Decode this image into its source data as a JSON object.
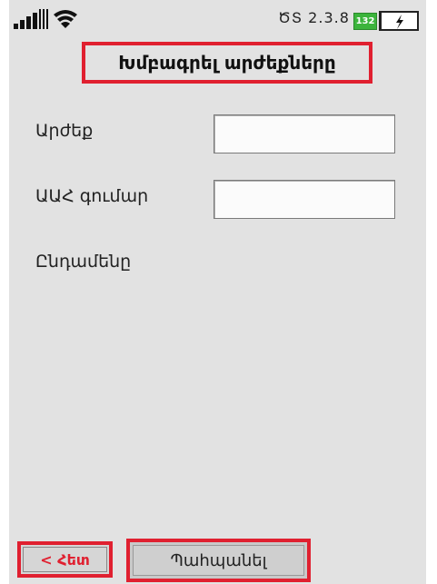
{
  "status_bar": {
    "signal_icon": "signal-strength-icon",
    "wifi_icon": "wifi-icon",
    "system_version": "ԾՏ 2.3.8",
    "battery_level": "132",
    "power_icon": "lightning-bolt-icon"
  },
  "header": {
    "title": "Խմբագրել արժեքները"
  },
  "form": {
    "value_label": "Արժեք",
    "value_input": "",
    "vat_label": "ԱԱՀ գումար",
    "vat_input": "",
    "total_label": "Ընդամենը"
  },
  "footer": {
    "back_label": "< Հետ",
    "save_label": "Պահպանել"
  },
  "colors": {
    "highlight": "#e02030",
    "background": "#e2e2e2",
    "battery": "#3cb43c"
  }
}
